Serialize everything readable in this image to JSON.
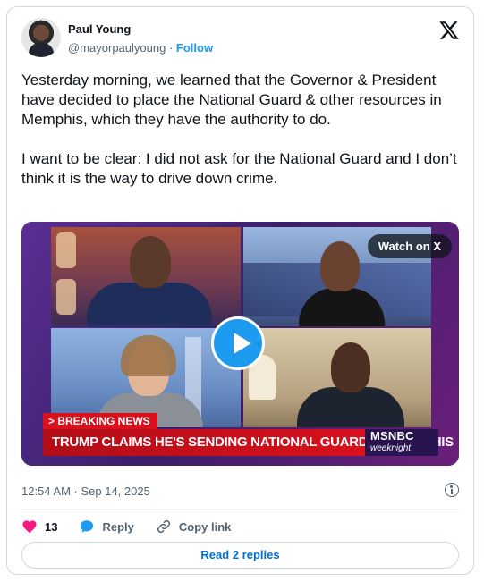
{
  "author": {
    "name": "Paul Young",
    "handle": "@mayorpaulyoung",
    "separator": "·",
    "follow_label": "Follow"
  },
  "tweet": {
    "paragraphs": [
      "Yesterday morning, we learned that the Governor & President have decided to place the National Guard & other resources in Memphis, which they have the authority to do.",
      "I want to be clear: I did not ask for the National Guard and I don’t think it is the way to drive down crime."
    ],
    "timestamp": "12:54 AM · Sep 14, 2025"
  },
  "media": {
    "watch_label": "Watch on X",
    "breaking_label": "> BREAKING NEWS",
    "chyron": "TRUMP CLAIMS HE'S SENDING NATIONAL GUARD TO MEMPHIS",
    "network": "MSNBC",
    "show": "weeknight"
  },
  "actions": {
    "likes": "13",
    "reply_label": "Reply",
    "copy_link_label": "Copy link"
  },
  "read_replies_label": "Read 2 replies",
  "colors": {
    "accent": "#1d9bf0",
    "like": "#f91880",
    "link": "#006fd6",
    "muted": "#536471"
  },
  "icons": [
    "x-logo-icon",
    "play-icon",
    "heart-icon",
    "reply-bubble-icon",
    "link-icon",
    "info-icon"
  ]
}
